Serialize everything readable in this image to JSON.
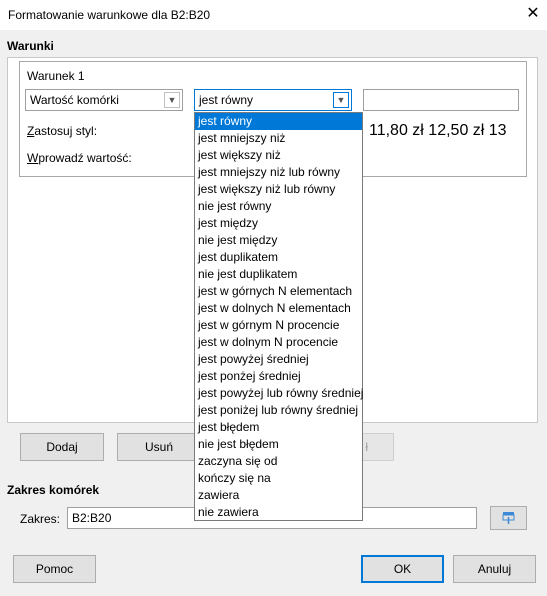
{
  "window": {
    "title": "Formatowanie warunkowe dla B2:B20",
    "close_glyph": "✕"
  },
  "conditions": {
    "section_title": "Warunki",
    "condition_label": "Warunek 1",
    "type_select_value": "Wartość komórki",
    "operator_select_value": "jest równy",
    "value_input": "",
    "apply_style_label": "Zastosuj styl:",
    "enter_value_label": "Wprowadź wartość:",
    "preview_text": "11,80 zł 12,50 zł 13"
  },
  "operator_options": [
    "jest równy",
    "jest mniejszy niż",
    "jest większy niż",
    "jest mniejszy niż lub równy",
    "jest większy niż lub równy",
    "nie jest równy",
    "jest między",
    "nie jest między",
    "jest duplikatem",
    "nie jest duplikatem",
    "jest w górnych N elementach",
    "jest w dolnych N elementach",
    "jest w górnym N procencie",
    "jest w dolnym N procencie",
    "jest powyżej średniej",
    "jest ponżej średniej",
    "jest powyżej lub równy średniej",
    "jest poniżej lub równy średniej",
    "jest błędem",
    "nie jest błędem",
    "zaczyna się od",
    "kończy się na",
    "zawiera",
    "nie zawiera"
  ],
  "buttons": {
    "add": "Dodaj",
    "remove": "Usuń",
    "hidden_partial": "ł",
    "help": "Pomoc",
    "ok": "OK",
    "cancel": "Anuluj"
  },
  "range": {
    "section_title": "Zakres komórek",
    "label": "Zakres:",
    "value": "B2:B20"
  },
  "colors": {
    "accent": "#0078d7",
    "selection_text": "#ffffff"
  }
}
